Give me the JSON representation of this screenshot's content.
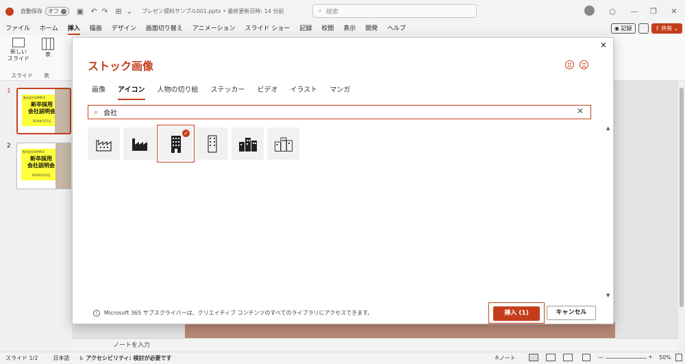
{
  "titlebar": {
    "autosave_label": "自動保存",
    "autosave_state": "オフ",
    "doc_title": "プレゼン資料サンプル001.pptx • 最終更新日時: 14 分前",
    "search_placeholder": "検索"
  },
  "menu": {
    "items": [
      "ファイル",
      "ホーム",
      "挿入",
      "描画",
      "デザイン",
      "画面切り替え",
      "アニメーション",
      "スライド ショー",
      "記録",
      "校閲",
      "表示",
      "開発",
      "ヘルプ"
    ],
    "active_index": 2,
    "record_button": "記録",
    "share_button": "共有"
  },
  "ribbon": {
    "new_slide": "新しい\nスライド",
    "table": "表",
    "group_slide": "スライド",
    "group_table": "表"
  },
  "thumbnails": [
    {
      "number": "1",
      "tiny": "株式会社SAMPLE",
      "title": "新卒採用\n会社説明会",
      "date": "2024年5月1日"
    },
    {
      "number": "2",
      "tiny": "株式会社SAMPLE",
      "title": "新卒採用\n会社説明会",
      "date": "2024年5月1日"
    }
  ],
  "dialog": {
    "title": "ストック画像",
    "tabs": [
      "画像",
      "アイコン",
      "人物の切り絵",
      "ステッカー",
      "ビデオ",
      "イラスト",
      "マンガ"
    ],
    "active_tab": 1,
    "search_value": "会社",
    "info_text": "Microsoft 365 サブスクライバーは、クリエイティブ コンテンツのすべてのライブラリにアクセスできます。",
    "insert_button": "挿入 (1)",
    "cancel_button": "キャンセル"
  },
  "notes_placeholder": "ノートを入力",
  "status": {
    "slide_position": "スライド 1/2",
    "language": "日本語",
    "accessibility": "アクセシビリティ: 検討が必要です",
    "notes_button": "ノート",
    "zoom": "50%"
  },
  "colors": {
    "accent": "#c43e1c"
  }
}
